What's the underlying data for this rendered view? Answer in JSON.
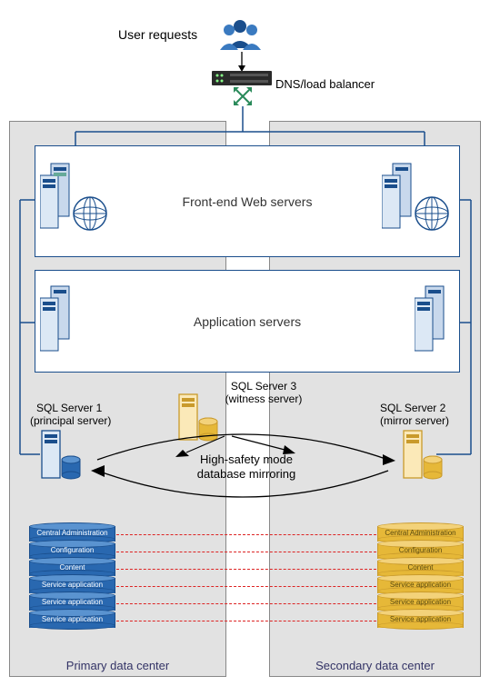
{
  "title": "User requests",
  "dns_label": "DNS/load balancer",
  "tiers": {
    "web": "Front-end Web servers",
    "app": "Application servers"
  },
  "sql": {
    "s1_name": "SQL Server 1",
    "s1_role": "(principal server)",
    "s2_name": "SQL Server 2",
    "s2_role": "(mirror server)",
    "s3_name": "SQL Server 3",
    "s3_role": "(witness server)",
    "mirroring_l1": "High-safety mode",
    "mirroring_l2": "database mirroring"
  },
  "databases": [
    "Central Administration",
    "Configuration",
    "Content",
    "Service application",
    "Service application",
    "Service application"
  ],
  "dc": {
    "primary": "Primary data center",
    "secondary": "Secondary data center"
  },
  "icons": {
    "users": "users-icon",
    "balancer": "load-balancer-icon",
    "server": "server-icon",
    "globe": "globe-icon",
    "db": "database-icon",
    "arrows": "expand-arrows-icon"
  },
  "colors": {
    "primary_blue": "#1a4e8c",
    "db_blue": "#2968b0",
    "db_yellow": "#e6b838",
    "yellow_outline": "#c99a2b",
    "dash_red": "#d22"
  }
}
